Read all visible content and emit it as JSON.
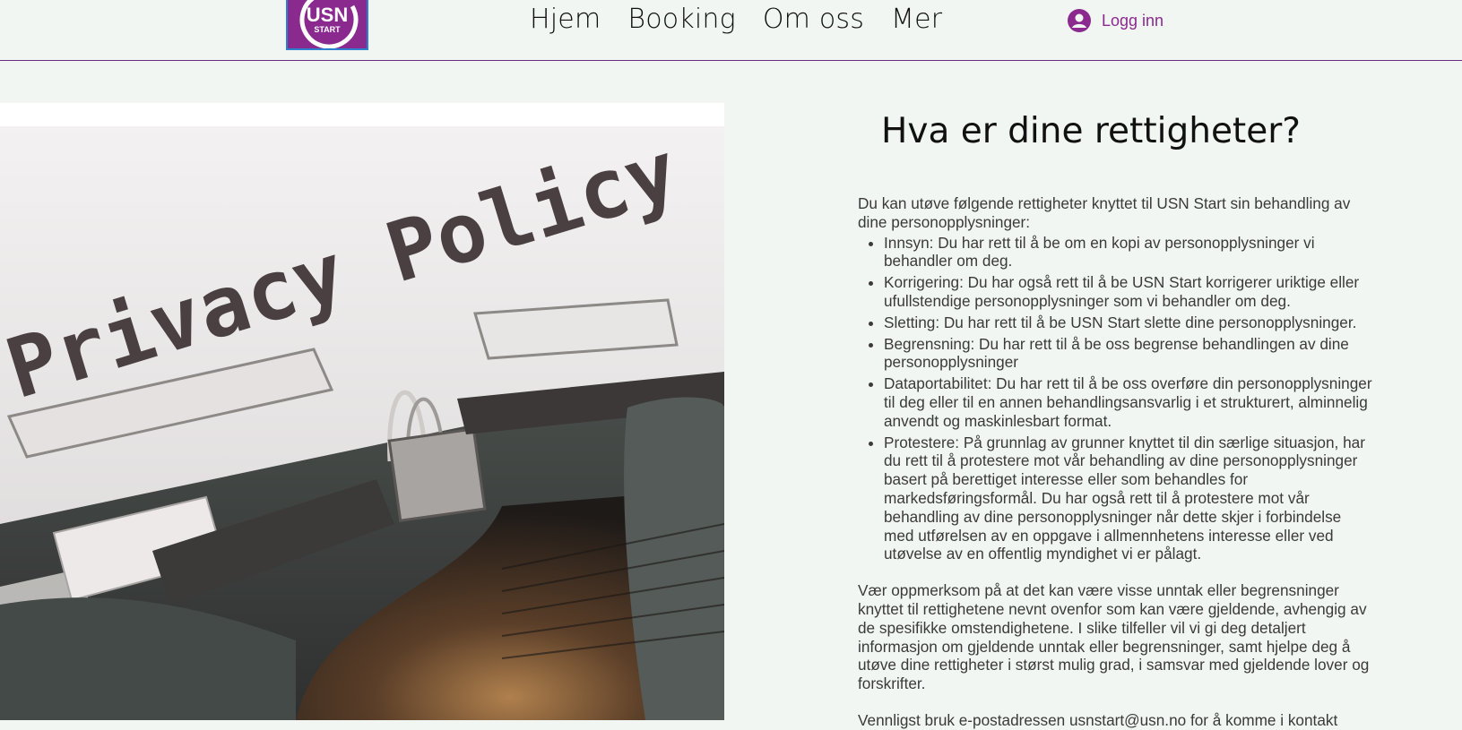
{
  "header": {
    "logo_text": "USN START",
    "nav": [
      "Hjem",
      "Booking",
      "Om oss",
      "Mer"
    ],
    "login_label": "Logg inn"
  },
  "photo": {
    "typewriter_text": "Privacy Policy"
  },
  "main": {
    "heading": "Hva er dine rettigheter?",
    "intro": "Du kan utøve følgende rettigheter knyttet til USN Start sin behandling av dine personopplysninger:",
    "rights": [
      "Innsyn: Du har rett til å be om en kopi av personopplysninger vi behandler om deg.",
      "Korrigering: Du har også rett til å be USN Start korrigerer uriktige eller ufullstendige personopplysninger som vi behandler om deg.",
      "Sletting: Du har rett til å be USN Start slette dine personopplysninger.",
      "Begrensning: Du har rett til å be oss begrense behandlingen av dine personopplysninger",
      "Dataportabilitet: Du har rett til å be oss overføre din personopplysninger til deg eller til en annen behandlingsansvarlig i et strukturert, alminnelig anvendt og maskinlesbart format.",
      "Protestere: På grunnlag av grunner knyttet til din særlige situasjon, har du rett til å protestere mot vår behandling av dine personopplysninger basert på berettiget interesse eller som behandles for markedsføringsformål. Du har også rett til å protestere mot vår behandling av dine personopplysninger når dette skjer i forbindelse med utførelsen av en oppgave i allmennhetens interesse eller ved utøvelse av en offentlig myndighet vi er pålagt."
    ],
    "paragraph": "Vær oppmerksom på at det kan være visse unntak eller begrensninger knyttet til rettighetene nevnt ovenfor som kan være gjeldende, avhengig av de spesifikke omstendighetene. I slike tilfeller vil vi gi deg detaljert informasjon om gjeldende unntak eller begrensninger, samt hjelpe deg å utøve dine rettigheter i størst mulig grad, i samsvar med gjeldende lover og forskrifter.",
    "cutoff_line": "Vennligst bruk e-postadressen usnstart@usn.no for å komme i kontakt"
  },
  "colors": {
    "brand_purple": "#8a2a8f",
    "background": "#f1f6f3"
  }
}
